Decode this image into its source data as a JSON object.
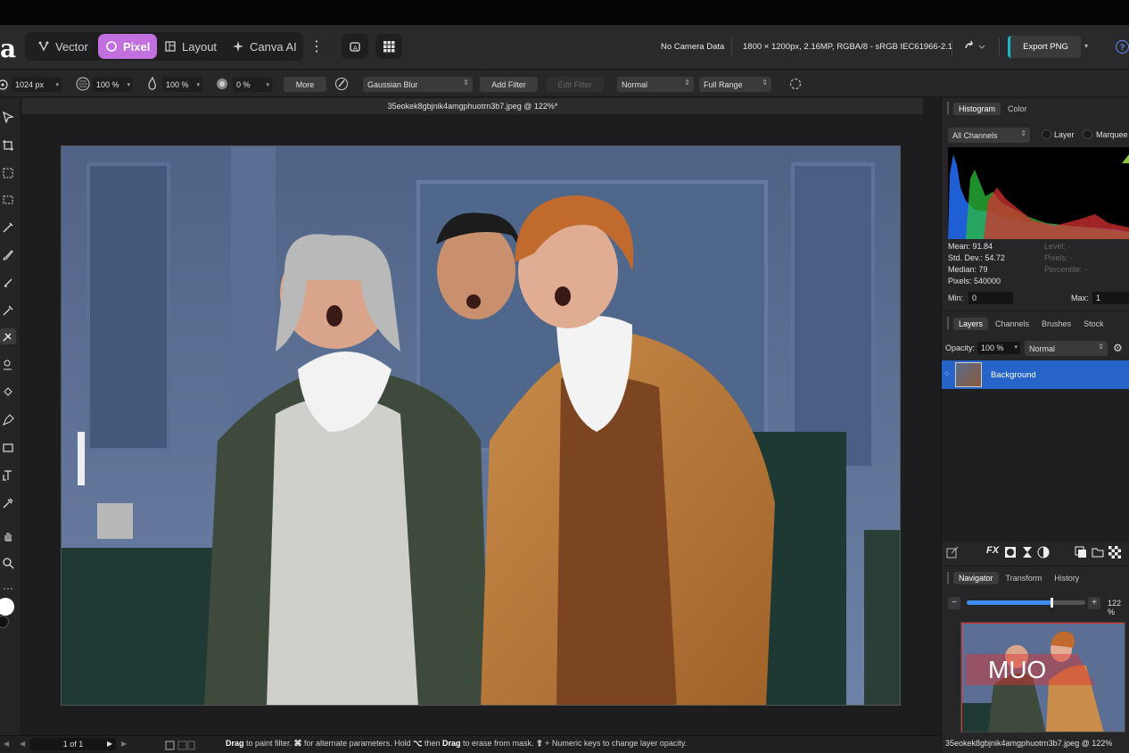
{
  "app": {
    "logo": "a",
    "personas": [
      {
        "label": "Vector"
      },
      {
        "label": "Pixel",
        "active": true
      },
      {
        "label": "Layout"
      },
      {
        "label": "Canva AI"
      }
    ]
  },
  "toolbar": {
    "camera": "No Camera Data",
    "image_info": "1800 × 1200px, 2.16MP, RGBA/8 - sRGB IEC61966-2.1",
    "export_label": "Export PNG",
    "help": "?"
  },
  "context": {
    "size": "1024 px",
    "opacity": "100 %",
    "flow": "100 %",
    "hardness": "0 %",
    "more": "More",
    "filter": "Gaussian Blur",
    "add_filter": "Add Filter",
    "edit_filter": "Edit Filter",
    "blend": "Normal",
    "range": "Full Range"
  },
  "document": {
    "title": "35eokek8gbjnik4amgphuotrn3b7.jpeg @ 122%*"
  },
  "statusbar": {
    "page": "1 of 1",
    "hint_drag": "Drag",
    "hint_1": " to paint filter. ",
    "hint_cmd": "⌘",
    "hint_2": " for alternate parameters. Hold ",
    "hint_opt": "⌥",
    "hint_3": " then ",
    "hint_drag2": "Drag",
    "hint_4": " to erase from mask. ",
    "hint_shift": "⇧",
    "hint_5": " + Numeric keys to change layer opacity."
  },
  "histogram": {
    "tabs": [
      "Histogram",
      "Color"
    ],
    "channels": "All Channels",
    "layer_label": "Layer",
    "marquee_label": "Marquee",
    "mean": "Mean: 91.84",
    "stddev": "Std. Dev.: 54.72",
    "median": "Median: 79",
    "pixels": "Pixels: 540000",
    "level": "Level: -",
    "pixels_r": "Pixels: -",
    "percentile": "Percentile: -",
    "min_label": "Min:",
    "min_value": "0",
    "max_label": "Max:",
    "max_value": "1"
  },
  "layers": {
    "tabs": [
      "Layers",
      "Channels",
      "Brushes",
      "Stock"
    ],
    "opacity_label": "Opacity:",
    "opacity_value": "100 %",
    "blend": "Normal",
    "items": [
      {
        "name": "Background"
      }
    ]
  },
  "navigator": {
    "tabs": [
      "Navigator",
      "Transform",
      "History"
    ],
    "zoom": "122 %",
    "zoom_fraction": 0.72,
    "watermark": "MUO",
    "doc_name": "35eokek8gbjnik4amgphuotrn3b7.jpeg @ 122%"
  },
  "colors": {
    "pixel_accent": "#c26fe0",
    "selection": "#2764c9",
    "export_accent": "#19b8c9"
  }
}
